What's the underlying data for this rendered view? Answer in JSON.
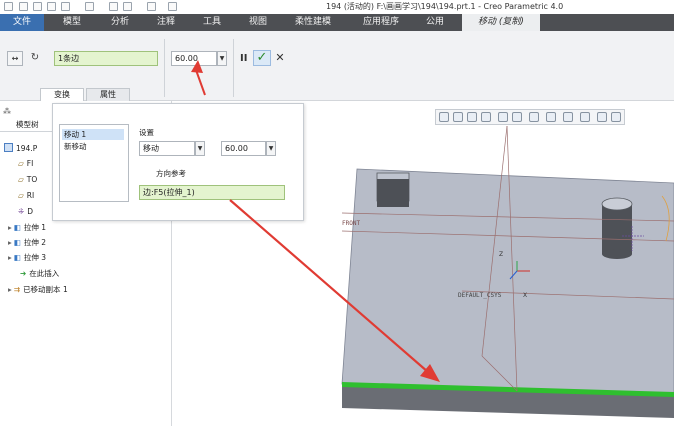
{
  "app": {
    "title": "194 (活动的) F:\\画画学习\\194\\194.prt.1 - Creo Parametric 4.0"
  },
  "ribbon": {
    "tabs": [
      {
        "label": "文件"
      },
      {
        "label": "模型"
      },
      {
        "label": "分析"
      },
      {
        "label": "注释"
      },
      {
        "label": "工具"
      },
      {
        "label": "视图"
      },
      {
        "label": "柔性建模"
      },
      {
        "label": "应用程序"
      },
      {
        "label": "公用"
      },
      {
        "label": "移动 (复制)"
      }
    ]
  },
  "dashboard": {
    "reference_field": "1条边",
    "distance_value": "60.00",
    "subtabs": [
      {
        "label": "变换"
      },
      {
        "label": "属性"
      }
    ]
  },
  "move_panel": {
    "items": [
      "移动 1",
      "新移动"
    ],
    "settings_label": "设置",
    "type_value": "移动",
    "distance_value": "60.00",
    "direction_label": "方向参考",
    "direction_value": "边:F5(拉伸_1)"
  },
  "model_tree": {
    "header": "模型树",
    "root": "194.P",
    "items": [
      {
        "label": "FI"
      },
      {
        "label": "TO"
      },
      {
        "label": "RI"
      },
      {
        "label": "D"
      },
      {
        "label": "拉伸 1"
      },
      {
        "label": "拉伸 2"
      },
      {
        "label": "拉伸 3"
      },
      {
        "label": "在此插入"
      },
      {
        "label": "已移动副本 1"
      }
    ]
  },
  "viewport": {
    "plane_labels": {
      "front": "FRONT",
      "default": "DEFAULT_CSYS"
    },
    "axis_labels": {
      "z": "Z",
      "x": "X"
    }
  },
  "colors": {
    "accent_tab": "#3a6fb0",
    "ribbon_bg": "#4d4f53",
    "annotation_arrow": "#e03b33",
    "highlight_edge": "#2fbf2f",
    "model_top": "#b7bcc8",
    "model_side": "#6a6d74"
  }
}
